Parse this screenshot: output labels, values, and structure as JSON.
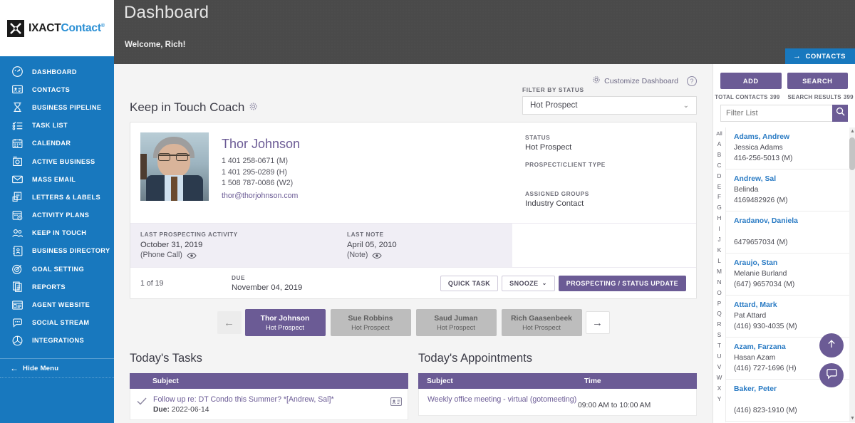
{
  "brand": {
    "logo_primary": "IXACT",
    "logo_secondary": "Contact",
    "logo_reg": "®",
    "accent_blue": "#1878be",
    "accent_purple": "#6b5b95",
    "link_blue": "#2a7bc4"
  },
  "sidebar": {
    "items": [
      {
        "label": "DASHBOARD",
        "icon": "gauge-icon"
      },
      {
        "label": "CONTACTS",
        "icon": "contact-card-icon"
      },
      {
        "label": "BUSINESS PIPELINE",
        "icon": "pipeline-icon"
      },
      {
        "label": "TASK LIST",
        "icon": "checklist-icon"
      },
      {
        "label": "CALENDAR",
        "icon": "calendar-icon"
      },
      {
        "label": "ACTIVE BUSINESS",
        "icon": "active-business-icon"
      },
      {
        "label": "MASS EMAIL",
        "icon": "envelope-icon"
      },
      {
        "label": "LETTERS & LABELS",
        "icon": "letters-labels-icon"
      },
      {
        "label": "ACTIVITY PLANS",
        "icon": "activity-plan-icon"
      },
      {
        "label": "KEEP IN TOUCH",
        "icon": "people-icon"
      },
      {
        "label": "BUSINESS DIRECTORY",
        "icon": "directory-icon"
      },
      {
        "label": "GOAL SETTING",
        "icon": "target-icon"
      },
      {
        "label": "REPORTS",
        "icon": "reports-icon"
      },
      {
        "label": "AGENT WEBSITE",
        "icon": "website-icon"
      },
      {
        "label": "SOCIAL STREAM",
        "icon": "chat-bubbles-icon"
      },
      {
        "label": "INTEGRATIONS",
        "icon": "integrations-icon"
      }
    ],
    "hide_menu_label": "Hide Menu"
  },
  "header": {
    "title": "Dashboard",
    "welcome": "Welcome, Rich!",
    "contacts_button": "CONTACTS"
  },
  "toolbar": {
    "customize_label": "Customize Dashboard",
    "help_glyph": "?"
  },
  "coach": {
    "section_title": "Keep in Touch Coach",
    "filter_label": "FILTER BY STATUS",
    "filter_value": "Hot Prospect",
    "contact": {
      "name": "Thor Johnson",
      "phones": [
        "1 401 258-0671 (M)",
        "1 401 295-0289 (H)",
        "1 508 787-0086 (W2)"
      ],
      "email": "thor@thorjohnson.com"
    },
    "status_label": "STATUS",
    "status_value": "Hot Prospect",
    "prospect_type_label": "PROSPECT/CLIENT TYPE",
    "prospect_type_value": "",
    "groups_label": "ASSIGNED GROUPS",
    "groups_value": "Industry Contact",
    "last_prospecting_label": "LAST PROSPECTING ACTIVITY",
    "last_prospecting_date": "October 31, 2019",
    "last_prospecting_type": "(Phone Call)",
    "last_note_label": "LAST NOTE",
    "last_note_date": "April 05, 2010",
    "last_note_type": "(Note)",
    "counter": "1 of 19",
    "due_label": "DUE",
    "due_date": "November 04, 2019",
    "quick_task_btn": "QUICK TASK",
    "snooze_btn": "SNOOZE",
    "status_update_btn": "PROSPECTING / STATUS UPDATE",
    "pager": [
      {
        "name": "Thor Johnson",
        "status": "Hot Prospect",
        "active": true
      },
      {
        "name": "Sue Robbins",
        "status": "Hot Prospect",
        "active": false
      },
      {
        "name": "Saud Juman",
        "status": "Hot Prospect",
        "active": false
      },
      {
        "name": "Rich Gaasenbeek",
        "status": "Hot Prospect",
        "active": false
      }
    ]
  },
  "tasks": {
    "title": "Today's Tasks",
    "column_subject": "Subject",
    "rows": [
      {
        "subject": "Follow up re: DT Condo this Summer? *[Andrew, Sal]*",
        "due_label": "Due:",
        "due_value": "2022-06-14"
      }
    ]
  },
  "appointments": {
    "title": "Today's Appointments",
    "column_subject": "Subject",
    "column_time": "Time",
    "rows": [
      {
        "subject": "Weekly office meeting - virtual (gotomeeting)",
        "time": "09:00 AM to 10:00 AM"
      }
    ]
  },
  "contacts_panel": {
    "add_button": "ADD",
    "search_button": "SEARCH",
    "total_contacts_label": "TOTAL CONTACTS",
    "total_contacts_value": "399",
    "search_results_label": "SEARCH RESULTS",
    "search_results_value": "399",
    "filter_placeholder": "Filter List",
    "filter_value": "",
    "alpha_index": [
      "All",
      "A",
      "B",
      "C",
      "D",
      "E",
      "F",
      "G",
      "H",
      "I",
      "J",
      "K",
      "L",
      "M",
      "N",
      "O",
      "P",
      "Q",
      "R",
      "S",
      "T",
      "U",
      "V",
      "W",
      "X",
      "Y"
    ],
    "list": [
      {
        "name": "Adams, Andrew",
        "spouse": "Jessica Adams",
        "phone": "416-256-5013 (M)"
      },
      {
        "name": "Andrew, Sal",
        "spouse": "Belinda",
        "phone": "4169482926 (M)"
      },
      {
        "name": "Aradanov, Daniela",
        "spouse": "",
        "phone": "6479657034 (M)"
      },
      {
        "name": "Araujo, Stan",
        "spouse": "Melanie Burland",
        "phone": "(647) 9657034 (M)"
      },
      {
        "name": "Attard, Mark",
        "spouse": "Pat Attard",
        "phone": "(416) 930-4035 (M)"
      },
      {
        "name": "Azam, Farzana",
        "spouse": "Hasan Azam",
        "phone": "(416) 727-1696 (H)"
      },
      {
        "name": "Baker, Peter",
        "spouse": "",
        "phone": "(416) 823-1910 (M)"
      }
    ]
  },
  "floating": {
    "scroll_top": "scroll-to-top",
    "chat": "chat"
  }
}
